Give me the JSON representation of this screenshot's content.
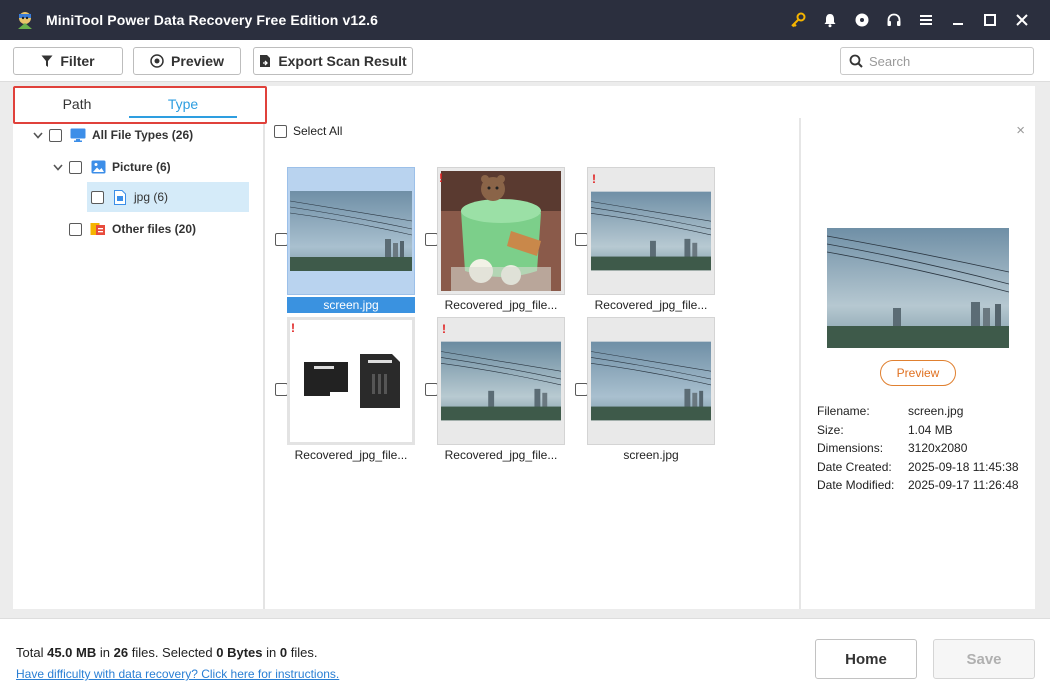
{
  "window": {
    "title": "MiniTool Power Data Recovery Free Edition v12.6",
    "icons": [
      "key-icon",
      "bell-icon",
      "disc-icon",
      "headset-icon",
      "menu-icon",
      "minimize-icon",
      "maximize-icon",
      "close-icon"
    ]
  },
  "toolbar": {
    "filter_label": "Filter",
    "preview_label": "Preview",
    "export_label": "Export Scan Result",
    "search_placeholder": "Search"
  },
  "tabs": {
    "path": "Path",
    "type": "Type",
    "active": "Type"
  },
  "tree": {
    "all": "All File Types (26)",
    "picture": "Picture (6)",
    "jpg": "jpg (6)",
    "other": "Other files (20)"
  },
  "grid": {
    "select_all": "Select All",
    "items": [
      {
        "name": "screen.jpg",
        "selected": true,
        "warning": false,
        "thumb": "sky-city"
      },
      {
        "name": "Recovered_jpg_file...",
        "selected": false,
        "warning": true,
        "thumb": "cake"
      },
      {
        "name": "Recovered_jpg_file...",
        "selected": false,
        "warning": true,
        "thumb": "sky-city"
      },
      {
        "name": "Recovered_jpg_file...",
        "selected": false,
        "warning": true,
        "thumb": "sd-card"
      },
      {
        "name": "Recovered_jpg_file...",
        "selected": false,
        "warning": true,
        "thumb": "sky-city"
      },
      {
        "name": "screen.jpg",
        "selected": false,
        "warning": false,
        "thumb": "sky-city"
      }
    ],
    "warning_mark": "!"
  },
  "preview": {
    "close": "×",
    "button": "Preview",
    "props": [
      {
        "key": "Filename:",
        "value": "screen.jpg"
      },
      {
        "key": "Size:",
        "value": "1.04 MB"
      },
      {
        "key": "Dimensions:",
        "value": "3120x2080"
      },
      {
        "key": "Date Created:",
        "value": "2025-09-18 11:45:38"
      },
      {
        "key": "Date Modified:",
        "value": "2025-09-17 11:26:48"
      }
    ]
  },
  "footer": {
    "summary": {
      "total_prefix": "Total",
      "total_size": "45.0 MB",
      "in1": "in",
      "total_files": "26",
      "files_selected": "files.  Selected",
      "selected_size": "0 Bytes",
      "in2": "in",
      "selected_files": "0",
      "files_end": "files."
    },
    "help_link": "Have difficulty with data recovery? Click here for instructions.",
    "home_label": "Home",
    "save_label": "Save"
  },
  "colors": {
    "titlebar": "#2b2f3e",
    "accent_blue": "#2e9ee0",
    "highlight_red": "#e0413b",
    "preview_orange": "#e07020",
    "key_gold": "#f5b400"
  }
}
